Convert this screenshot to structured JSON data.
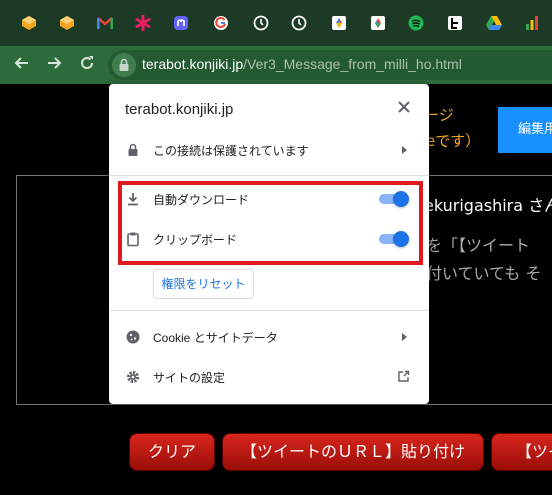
{
  "bookmarks": [
    {
      "icon": "orange-cube-icon",
      "color": "#f5a623"
    },
    {
      "icon": "orange-cube-icon",
      "color": "#f5a623"
    },
    {
      "icon": "gmail-icon",
      "color": "#ea4335"
    },
    {
      "icon": "asterisk-icon",
      "color": "#e91e63"
    },
    {
      "icon": "mastodon-icon",
      "color": "#6364ff"
    },
    {
      "icon": "google-icon",
      "color": "#4285f4"
    },
    {
      "icon": "clock-icon",
      "color": "#ffffff"
    },
    {
      "icon": "clock-icon",
      "color": "#ffffff"
    },
    {
      "icon": "colorful-diamond-icon",
      "color": "#fbbc05"
    },
    {
      "icon": "colorful-diamond-icon",
      "color": "#34a853"
    },
    {
      "icon": "spotify-icon",
      "color": "#1db954"
    },
    {
      "icon": "bracket-logo-icon",
      "color": "#ffffff"
    },
    {
      "icon": "google-drive-icon",
      "color": "#fbbc05"
    },
    {
      "icon": "bar-chart-icon",
      "color": "#34a853"
    }
  ],
  "address_bar": {
    "host": "terabot.konjiki.jp",
    "path": "/Ver3_Message_from_milli_ho.html"
  },
  "page": {
    "line1": "ージ",
    "line2": "eです）",
    "edit_button": "編集用",
    "name_text": "ekurigashira さん",
    "text_line1": "を「【ツイート",
    "text_line2": "付いていても そ",
    "buttons": {
      "clear": "クリア",
      "paste_url": "【ツイートのＵＲＬ】貼り付け",
      "tweet": "【ツイ"
    }
  },
  "popup": {
    "site": "terabot.konjiki.jp",
    "connection": "この接続は保護されています",
    "auto_download": "自動ダウンロード",
    "clipboard": "クリップボード",
    "reset": "権限をリセット",
    "cookies": "Cookie とサイトデータ",
    "site_settings": "サイトの設定",
    "auto_download_on": true,
    "clipboard_on": true
  },
  "colors": {
    "accent": "#1a73e8",
    "highlight": "#e0191e",
    "page_orange": "#f5a623"
  }
}
